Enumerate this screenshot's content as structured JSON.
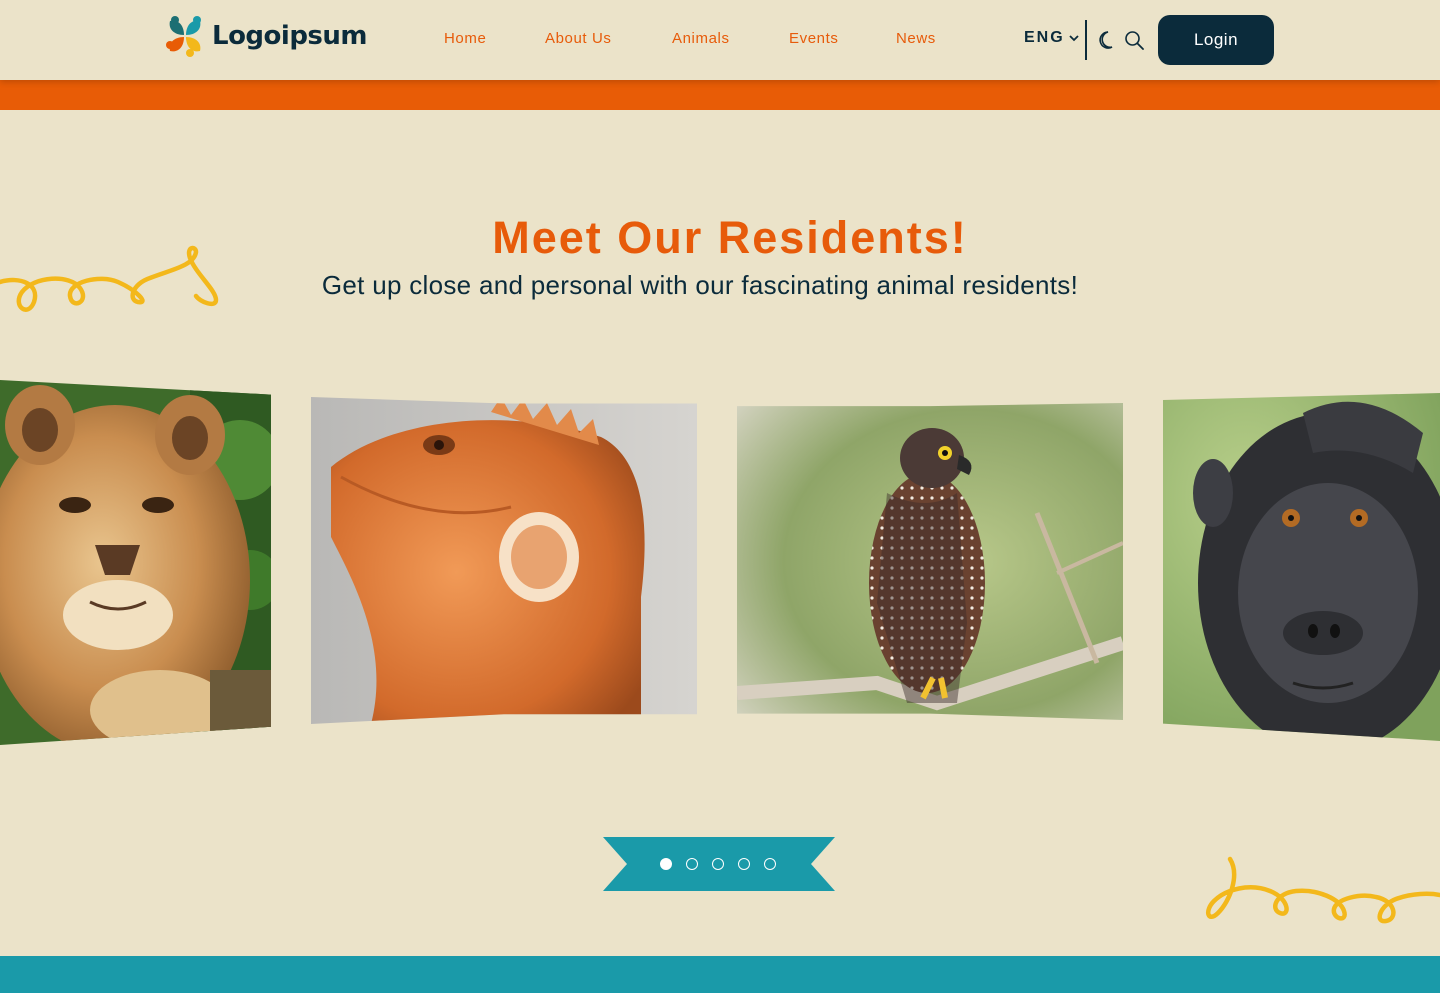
{
  "brand": {
    "name": "Logoipsum"
  },
  "nav": [
    {
      "label": "Home"
    },
    {
      "label": "About Us"
    },
    {
      "label": "Animals"
    },
    {
      "label": "Events"
    },
    {
      "label": "News"
    }
  ],
  "language": {
    "selected": "ENG",
    "icon": "chevron-down-icon"
  },
  "header_icons": [
    "moon-icon",
    "search-icon"
  ],
  "login": {
    "label": "Login"
  },
  "hero": {
    "title": "Meet Our Residents!",
    "subtitle": "Get up close and personal with our fascinating animal residents!"
  },
  "carousel": {
    "cards": [
      {
        "animal": "lioness"
      },
      {
        "animal": "iguana"
      },
      {
        "animal": "hawk-eagle"
      },
      {
        "animal": "macaque"
      }
    ],
    "dots": 5,
    "active_dot": 1
  },
  "colors": {
    "background": "#ebe3c9",
    "accent_orange": "#e85c06",
    "navy": "#0b2b3b",
    "teal": "#1a9aa9",
    "squiggle_yellow": "#f3b81b"
  }
}
